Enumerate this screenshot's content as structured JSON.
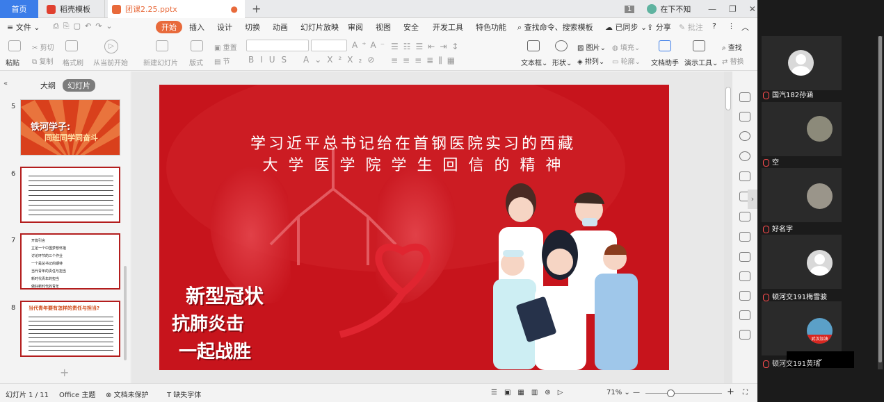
{
  "tabs": {
    "home": "首页",
    "docer": "稻壳模板",
    "doc": "团课2.25.pptx"
  },
  "window": {
    "badge": "1",
    "user": "在下不知"
  },
  "menu": [
    "文件",
    "开始",
    "插入",
    "设计",
    "切换",
    "动画",
    "幻灯片放映",
    "审阅",
    "视图",
    "安全",
    "开发工具",
    "特色功能",
    "查找命令、搜索模板",
    "已同步",
    "分享",
    "批注"
  ],
  "ribbon": {
    "paste": "粘贴",
    "cut": "剪切",
    "copy": "复制",
    "format": "格式刷",
    "from_current": "从当前开始",
    "new_slide": "新建幻灯片",
    "layout": "版式",
    "section": "节",
    "reset": "重置",
    "textbox": "文本框",
    "shape": "形状",
    "arrange": "排列",
    "picture": "图片",
    "fill": "填充",
    "outline": "轮廓",
    "doc_helper": "文档助手",
    "presenter": "演示工具",
    "find": "查找",
    "replace": "替换"
  },
  "panel": {
    "outline": "大纲",
    "slides": "幻灯片"
  },
  "thumbs": [
    {
      "num": "5",
      "title": "铁河学子:",
      "sub": "同班同学同奋斗"
    },
    {
      "num": "6"
    },
    {
      "num": "7",
      "lines": [
        "开篇引言",
        "立足一个中国梦想怀抱",
        "讨论环节的三个作业",
        "一个是总书记的期待",
        "当代青年的责任与担当",
        "新时代青年的担当",
        "做好新时代的青年"
      ]
    },
    {
      "num": "8",
      "title": "当代青年要有怎样的责任与担当?"
    }
  ],
  "slide": {
    "title_line1": "学习近平总书记给在首钢医院实习的西藏",
    "title_line2": "大 学 医 学 院 学 生 回 信 的 精 神",
    "calligraphy_line1": "新型冠状",
    "calligraphy_line2": "抗肺炎击",
    "calligraphy_line3": "一起战胜"
  },
  "status": {
    "slide_count": "幻灯片 1 / 11",
    "theme": "Office 主题",
    "protect": "文档未保护",
    "missing_font": "缺失字体",
    "zoom": "71%"
  },
  "participants": [
    {
      "name": "国汽182孙涵"
    },
    {
      "name": "空"
    },
    {
      "name": "好名字"
    },
    {
      "name": "顿河交191梅雪骏"
    },
    {
      "name": "顿河交191黄瑞",
      "avatar_text": "武汉加油"
    }
  ],
  "colors": {
    "accent": "#e86a3b",
    "slide_red": "#c7141c",
    "home_tab": "#3b7de9"
  }
}
